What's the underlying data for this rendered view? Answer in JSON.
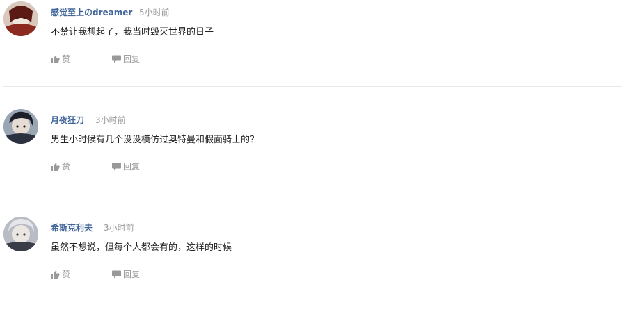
{
  "comments": [
    {
      "username": "感觉至上のdreamer",
      "time": "5小时前",
      "text": "不禁让我想起了，我当时毁灭世界的日子",
      "like_label": "赞",
      "reply_label": "回复"
    },
    {
      "username": "月夜狂刀",
      "time": "3小时前",
      "text": "男生小时候有几个没没模仿过奥特曼和假面骑士的？",
      "like_label": "赞",
      "reply_label": "回复"
    },
    {
      "username": "希斯克利夫",
      "time": "3小时前",
      "text": "虽然不想说，但每个人都会有的，这样的时候",
      "like_label": "赞",
      "reply_label": "回复"
    }
  ],
  "colors": {
    "username": "#406599",
    "meta": "#999999",
    "text": "#222222",
    "divider": "#e8e8e8"
  },
  "icons": {
    "like": "thumbs-up-icon",
    "reply": "speech-bubble-icon"
  }
}
